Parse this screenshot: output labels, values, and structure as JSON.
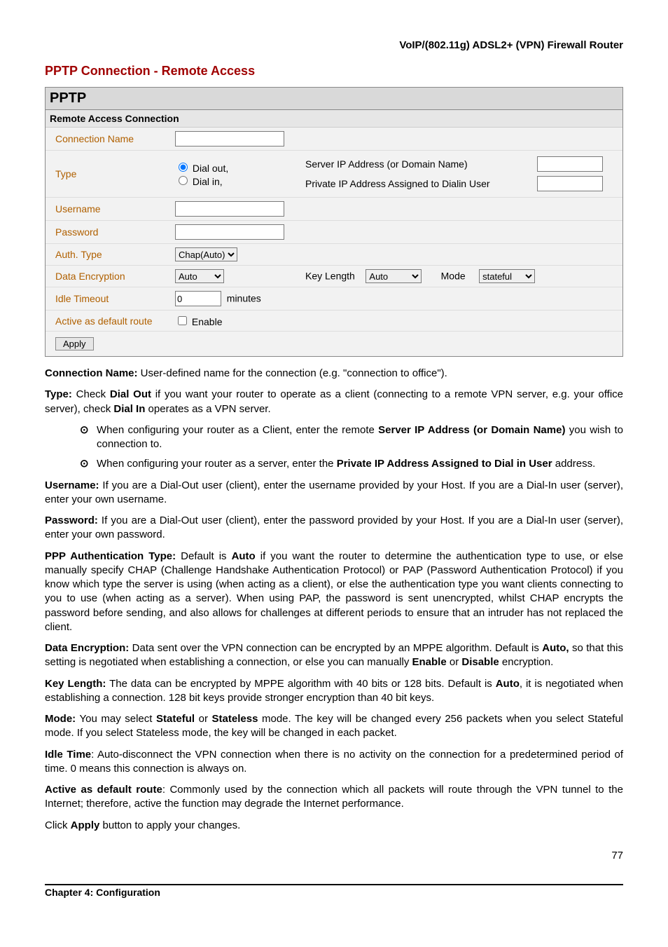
{
  "header": {
    "product": "VoIP/(802.11g) ADSL2+ (VPN) Firewall Router"
  },
  "section_title": "PPTP Connection - Remote Access",
  "panel": {
    "title": "PPTP",
    "subheader": "Remote Access Connection",
    "rows": {
      "connection_name": {
        "label": "Connection Name",
        "value": ""
      },
      "type": {
        "label": "Type",
        "dial_out": "Dial out,",
        "dial_in": "Dial in,",
        "server_ip_label": "Server IP Address (or Domain Name)",
        "private_ip_label": "Private IP Address Assigned to Dialin User",
        "server_ip_value": "",
        "private_ip_value": ""
      },
      "username": {
        "label": "Username",
        "value": ""
      },
      "password": {
        "label": "Password",
        "value": ""
      },
      "auth_type": {
        "label": "Auth. Type",
        "value": "Chap(Auto)"
      },
      "data_enc": {
        "label": "Data Encryption",
        "value": "Auto",
        "key_length_label": "Key Length",
        "key_length_value": "Auto",
        "mode_label": "Mode",
        "mode_value": "stateful"
      },
      "idle_timeout": {
        "label": "Idle Timeout",
        "value": "0",
        "unit": "minutes"
      },
      "default_route": {
        "label": "Active as default route",
        "enable_label": "Enable"
      }
    },
    "apply": "Apply"
  },
  "desc": {
    "conn_name": {
      "label": "Connection Name:",
      "text": " User-defined name for the connection (e.g. \"connection to office\")."
    },
    "type": {
      "label": "Type:",
      "t1": " Check ",
      "b1": "Dial Out",
      "t2": " if you want your router to operate as a client (connecting to a remote VPN server, e.g. your office server), check ",
      "b2": "Dial In",
      "t3": " operates as a VPN server."
    },
    "bullet1": {
      "t1": "When configuring your router as a Client, enter the remote ",
      "b1": "Server IP Address (or Domain Name)",
      "t2": " you wish to connection to."
    },
    "bullet2": {
      "t1": "When configuring your router as a server, enter the ",
      "b1": "Private IP Address Assigned to Dial in User",
      "t2": " address."
    },
    "username": {
      "label": "Username:",
      "text": " If you are a Dial-Out user (client), enter the username provided by your Host.   If you are a Dial-In user (server), enter your own username."
    },
    "password": {
      "label": "Password:",
      "text": " If you are a Dial-Out user (client), enter the password provided by your Host.   If you are a Dial-In user (server), enter your own password."
    },
    "ppp_auth": {
      "label": "PPP Authentication Type:",
      "t1": " Default is ",
      "b1": "Auto",
      "t2": " if you want the router to determine the authentication type to use, or else manually specify CHAP (Challenge Handshake Authentication Protocol) or PAP (Password Authentication Protocol) if you know which type the server is using (when acting as a client), or else the authentication type you want clients connecting to you to use (when acting as a server). When using PAP, the password is sent unencrypted, whilst CHAP encrypts the password before sending, and also allows for challenges at different periods to ensure that an intruder has not replaced the client."
    },
    "data_enc": {
      "label": "Data Encryption:",
      "t1": " Data sent over the VPN connection can be encrypted by an MPPE algorithm. Default is ",
      "b1": "Auto,",
      "t2": " so that this setting is negotiated when establishing a connection, or else you can manually ",
      "b2": "Enable",
      "t3": " or ",
      "b3": "Disable",
      "t4": " encryption."
    },
    "key_len": {
      "label": "Key Length:",
      "t1": " The data can be encrypted by MPPE algorithm with 40 bits or 128 bits. Default is ",
      "b1": "Auto",
      "t2": ", it is negotiated when establishing a connection. 128 bit keys provide stronger encryption than 40 bit keys."
    },
    "mode": {
      "label": "Mode:",
      "t1": " You may select ",
      "b1": "Stateful",
      "t2": " or ",
      "b2": "Stateless",
      "t3": " mode. The key will be changed every 256 packets when you select Stateful mode. If you select Stateless mode, the key will be changed in each packet."
    },
    "idle": {
      "label": "Idle Time",
      "text": ": Auto-disconnect the VPN connection when there is no activity on the connection for a predetermined period of time. 0 means this connection is always on."
    },
    "active": {
      "label": "Active as default route",
      "text": ": Commonly used by the             connection which all packets will route through the VPN tunnel to the Internet; therefore, active the function may degrade the Internet performance."
    },
    "click_apply": {
      "t1": "Click ",
      "b1": "Apply",
      "t2": " button to apply your changes."
    }
  },
  "footer": {
    "chapter": "Chapter 4: Configuration",
    "page": "77"
  }
}
